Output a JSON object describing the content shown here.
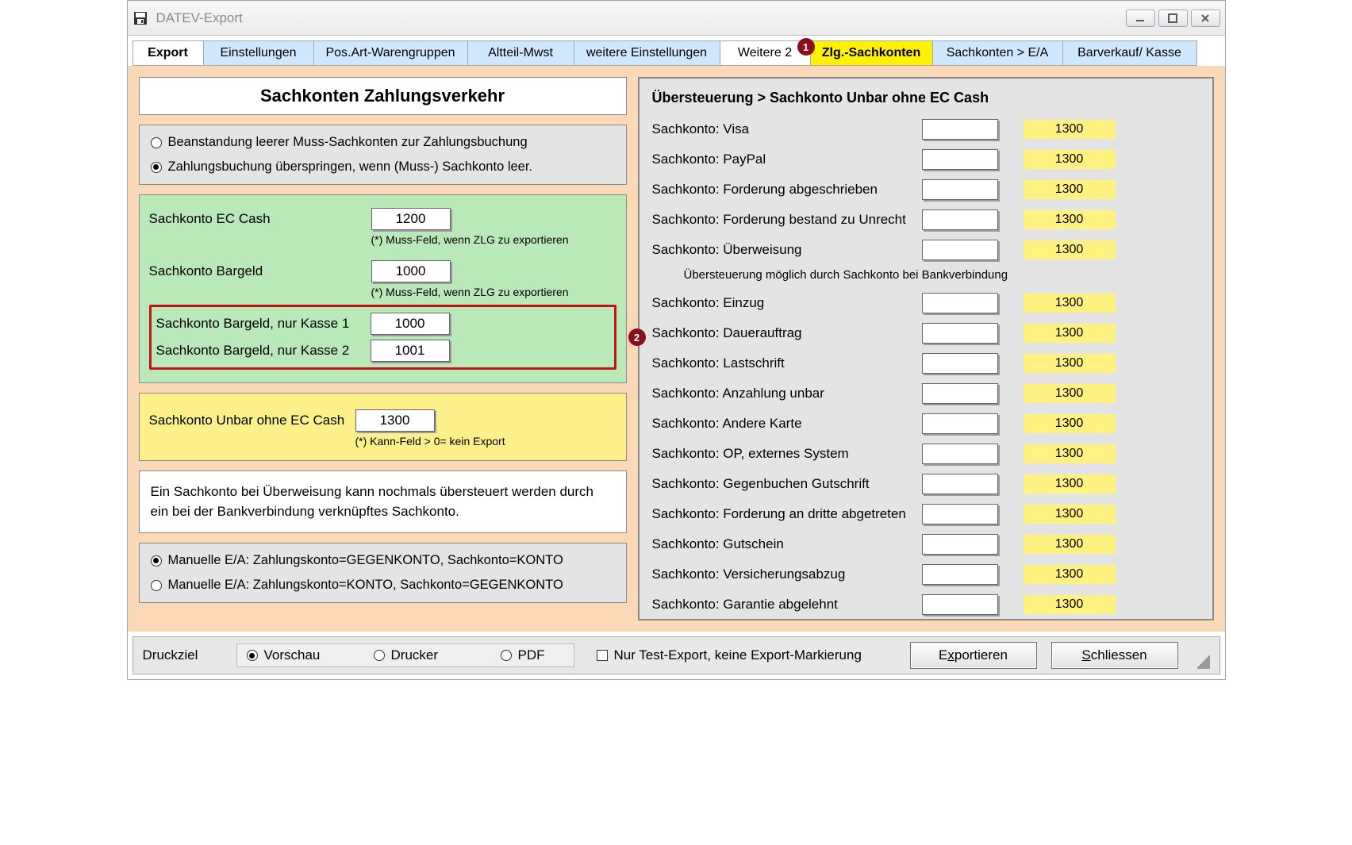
{
  "window": {
    "title": "DATEV-Export"
  },
  "annotations": {
    "one": "1",
    "two": "2"
  },
  "tabs": [
    "Export",
    "Einstellungen",
    "Pos.Art-Warengruppen",
    "Altteil-Mwst",
    "weitere Einstellungen",
    "Weitere 2",
    "Zlg.-Sachkonten",
    "Sachkonten > E/A",
    "Barverkauf/ Kasse"
  ],
  "left": {
    "title": "Sachkonten Zahlungsverkehr",
    "radio1": "Beanstandung leerer Muss-Sachkonten zur Zahlungsbuchung",
    "radio2": "Zahlungsbuchung überspringen, wenn (Muss-) Sachkonto leer.",
    "ec_label": "Sachkonto EC Cash",
    "ec_value": "1200",
    "ec_hint": "(*) Muss-Feld, wenn ZLG zu exportieren",
    "bar_label": "Sachkonto Bargeld",
    "bar_value": "1000",
    "bar_hint": "(*) Muss-Feld, wenn ZLG zu exportieren",
    "bar_k1_label": "Sachkonto Bargeld, nur Kasse 1",
    "bar_k1_value": "1000",
    "bar_k2_label": "Sachkonto Bargeld, nur Kasse 2",
    "bar_k2_value": "1001",
    "unbar_label": "Sachkonto Unbar ohne EC Cash",
    "unbar_value": "1300",
    "unbar_hint": "(*) Kann-Feld > 0= kein Export",
    "note": "Ein Sachkonto bei Überweisung kann nochmals übersteuert werden durch ein bei der Bankverbindung verknüpftes Sachkonto.",
    "ea_radio1": "Manuelle E/A: Zahlungskonto=GEGENKONTO, Sachkonto=KONTO",
    "ea_radio2": "Manuelle E/A: Zahlungskonto=KONTO, Sachkonto=GEGENKONTO"
  },
  "right": {
    "title": "Übersteuerung > Sachkonto Unbar ohne EC Cash",
    "note": "Übersteuerung möglich durch Sachkonto bei Bankverbindung",
    "value": "1300",
    "rows": [
      "Sachkonto: Visa",
      "Sachkonto: PayPal",
      "Sachkonto: Forderung abgeschrieben",
      "Sachkonto: Forderung bestand zu Unrecht",
      "Sachkonto: Überweisung",
      "Sachkonto: Einzug",
      "Sachkonto: Dauerauftrag",
      "Sachkonto: Lastschrift",
      "Sachkonto: Anzahlung unbar",
      "Sachkonto: Andere Karte",
      "Sachkonto: OP, externes System",
      "Sachkonto: Gegenbuchen Gutschrift",
      "Sachkonto: Forderung an dritte abgetreten",
      "Sachkonto: Gutschein",
      "Sachkonto: Versicherungsabzug",
      "Sachkonto: Garantie abgelehnt"
    ]
  },
  "bottom": {
    "druckziel": "Druckziel",
    "vorschau": "Vorschau",
    "drucker": "Drucker",
    "pdf": "PDF",
    "testexport": "Nur Test-Export, keine Export-Markierung",
    "export_pre": "E",
    "export_u": "x",
    "export_post": "portieren",
    "close_pre": "",
    "close_u": "S",
    "close_post": "chliessen"
  }
}
